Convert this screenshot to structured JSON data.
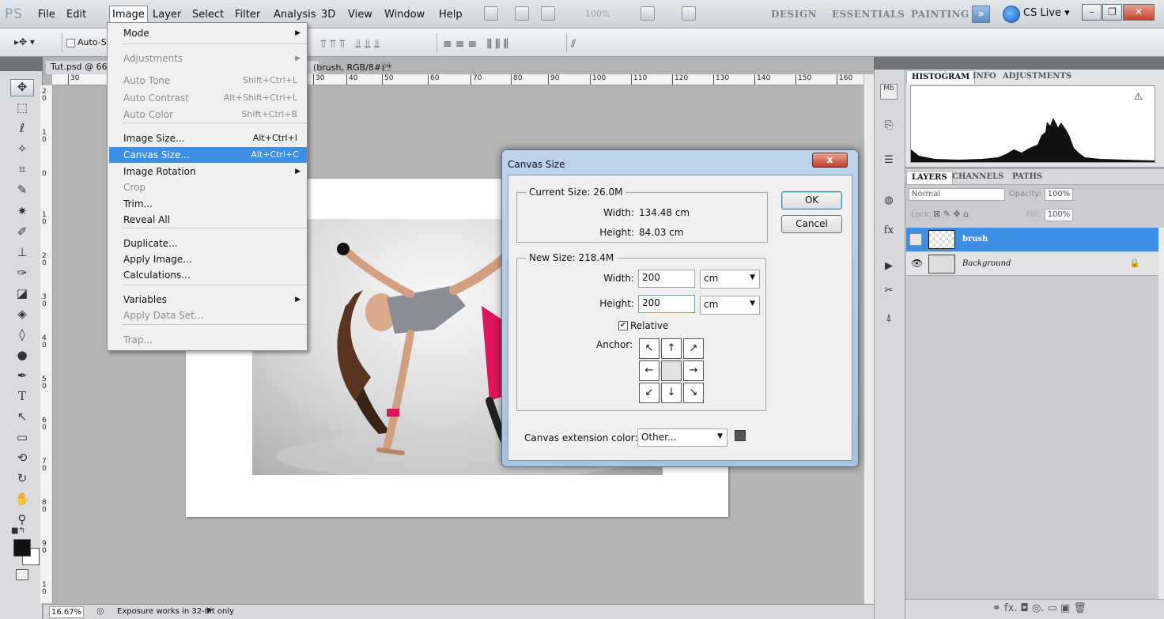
{
  "app": {
    "logo": "PS"
  },
  "menubar": {
    "items": [
      "File",
      "Edit",
      "Image",
      "Layer",
      "Select",
      "Filter",
      "Analysis",
      "3D",
      "View",
      "Window",
      "Help"
    ],
    "zoom": "100%",
    "workspaces": [
      "DESIGN",
      "ESSENTIALS",
      "PAINTING"
    ],
    "workspace_more": "»",
    "cslive": "CS Live ▾"
  },
  "window_controls": {
    "minimize": "–",
    "restore": "❐",
    "close": "✕"
  },
  "options_bar": {
    "tool_glyph": "▸✥ ▾",
    "auto_select": "Auto-Se"
  },
  "document": {
    "tab_title": "Tut.psd @ 66",
    "tab_suffix": "(brush, RGB/8#) *",
    "tab_close": "×",
    "ruler_top_ticks": [
      "30",
      "30",
      "40",
      "50",
      "60",
      "70",
      "80",
      "90",
      "100",
      "110",
      "120",
      "130",
      "140",
      "150",
      "160"
    ],
    "ruler_left_ticks": [
      "2 0",
      "1 0",
      "0",
      "1 0",
      "2 0",
      "3 0",
      "4 0",
      "5 0",
      "6 0",
      "7 0",
      "8 0",
      "9 0",
      "1 0"
    ],
    "canvas_ext_color": "#ffffff"
  },
  "status": {
    "zoom": "16.67%",
    "text": "Exposure works in 32-bit only",
    "arrow": "▶"
  },
  "image_menu": {
    "items": [
      {
        "label": "Mode",
        "shortcut": "",
        "submenu": true,
        "disabled": false
      },
      {
        "label": "Adjustments",
        "shortcut": "",
        "submenu": true,
        "disabled": true
      },
      {
        "label": "Auto Tone",
        "shortcut": "Shift+Ctrl+L",
        "submenu": false,
        "disabled": true
      },
      {
        "label": "Auto Contrast",
        "shortcut": "Alt+Shift+Ctrl+L",
        "submenu": false,
        "disabled": true
      },
      {
        "label": "Auto Color",
        "shortcut": "Shift+Ctrl+B",
        "submenu": false,
        "disabled": true
      },
      {
        "label": "Image Size...",
        "shortcut": "Alt+Ctrl+I",
        "submenu": false,
        "disabled": false
      },
      {
        "label": "Canvas Size...",
        "shortcut": "Alt+Ctrl+C",
        "submenu": false,
        "disabled": false,
        "highlighted": true
      },
      {
        "label": "Image Rotation",
        "shortcut": "",
        "submenu": true,
        "disabled": false
      },
      {
        "label": "Crop",
        "shortcut": "",
        "submenu": false,
        "disabled": true
      },
      {
        "label": "Trim...",
        "shortcut": "",
        "submenu": false,
        "disabled": false
      },
      {
        "label": "Reveal All",
        "shortcut": "",
        "submenu": false,
        "disabled": false
      },
      {
        "label": "Duplicate...",
        "shortcut": "",
        "submenu": false,
        "disabled": false
      },
      {
        "label": "Apply Image...",
        "shortcut": "",
        "submenu": false,
        "disabled": false
      },
      {
        "label": "Calculations...",
        "shortcut": "",
        "submenu": false,
        "disabled": false
      },
      {
        "label": "Variables",
        "shortcut": "",
        "submenu": true,
        "disabled": false
      },
      {
        "label": "Apply Data Set...",
        "shortcut": "",
        "submenu": false,
        "disabled": true
      },
      {
        "label": "Trap...",
        "shortcut": "",
        "submenu": false,
        "disabled": true
      }
    ]
  },
  "canvas_dialog": {
    "title": "Canvas Size",
    "close": "x",
    "current_size_title": "Current Size: 26.0M",
    "current_width_label": "Width:",
    "current_width_value": "134.48 cm",
    "current_height_label": "Height:",
    "current_height_value": "84.03 cm",
    "new_size_title": "New Size: 218.4M",
    "new_width_label": "Width:",
    "new_width_value": "200",
    "new_width_unit": "cm",
    "new_height_label": "Height:",
    "new_height_value": "200",
    "new_height_unit": "cm",
    "relative_label": "Relative",
    "relative_checked": true,
    "anchor_label": "Anchor:",
    "anchor_glyphs": [
      "↖",
      "↑",
      "↗",
      "←",
      "",
      "→",
      "↙",
      "↓",
      "↘"
    ],
    "ext_color_label": "Canvas extension color:",
    "ext_color_value": "Other...",
    "ext_color_swatch": "#555555",
    "ok_label": "OK",
    "cancel_label": "Cancel"
  },
  "histogram_panel": {
    "tabs": [
      "HISTOGRAM",
      "INFO",
      "ADJUSTMENTS"
    ],
    "active_tab": "HISTOGRAM",
    "warning_icon": "⚠"
  },
  "layers_panel": {
    "tabs": [
      "LAYERS",
      "CHANNELS",
      "PATHS"
    ],
    "active_tab": "LAYERS",
    "blend_mode": "Normal",
    "opacity_label": "Opacity:",
    "opacity": "100%",
    "lock_label": "Lock:",
    "fill_label": "Fill:",
    "fill": "100%",
    "layers": [
      {
        "name": "brush",
        "selected": true
      },
      {
        "name": "Background",
        "selected": false
      }
    ],
    "bottom_icons": "⚭  fx.  ◘  ◎.  ▭  ▣  🗑"
  },
  "colors": {
    "accent": "#3d8ee4",
    "foreground": "#111111",
    "background": "#ffffff"
  }
}
